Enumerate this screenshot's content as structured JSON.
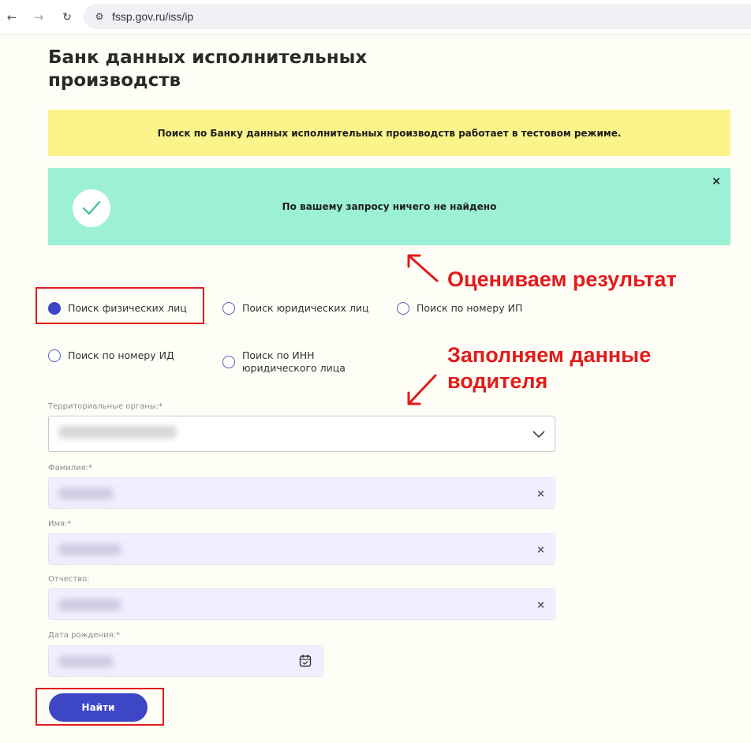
{
  "browser": {
    "back_icon": "←",
    "forward_icon": "→",
    "reload_icon": "↻",
    "site_settings_icon": "⚙",
    "url": "fssp.gov.ru/iss/ip"
  },
  "page": {
    "title": "Банк данных исполнительных производств",
    "test_notice": "Поиск по Банку данных исполнительных производств работает в тестовом режиме.",
    "result_message": "По вашему запросу ничего не найдено",
    "result_close": "×",
    "result_bg_color": "#9cf0d6",
    "notice_bg_color": "#fbf48a"
  },
  "annotations": {
    "evaluate_result": "Оцениваем результат",
    "fill_driver": "Заполняем данные водителя",
    "color": "#e21b1b"
  },
  "search_modes": [
    {
      "label": "Поиск физических лиц",
      "checked": true
    },
    {
      "label": "Поиск юридических лиц",
      "checked": false
    },
    {
      "label": "Поиск по номеру ИП",
      "checked": false
    },
    {
      "label": "Поиск по номеру ИД",
      "checked": false
    },
    {
      "label": "Поиск по ИНН юридического лица",
      "checked": false
    }
  ],
  "form": {
    "territory_label": "Территориальные органы:*",
    "surname_label": "Фамилия:*",
    "name_label": "Имя:*",
    "patronymic_label": "Отчество:",
    "birthdate_label": "Дата рождения:*",
    "clear_icon": "×",
    "submit_label": "Найти",
    "accent_color": "#3d47c6"
  }
}
